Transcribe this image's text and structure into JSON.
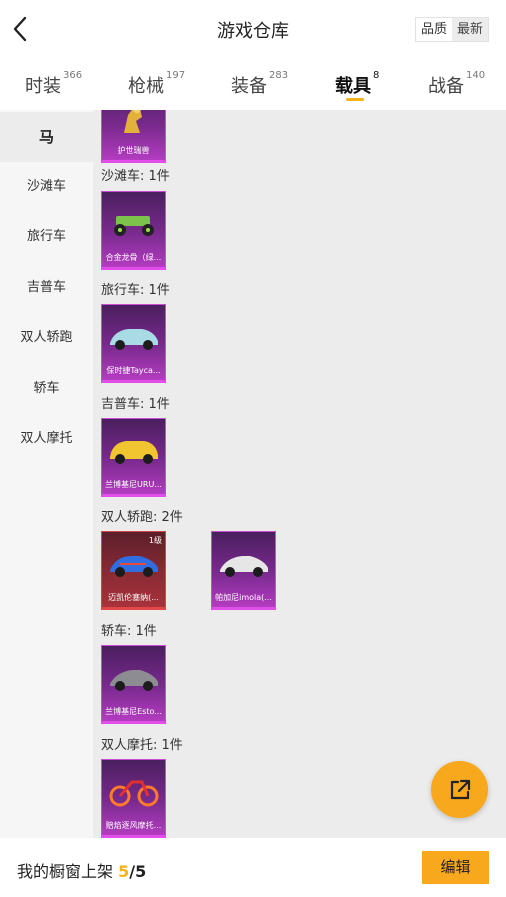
{
  "header": {
    "title": "游戏仓库",
    "sort_quality": "品质",
    "sort_newest": "最新"
  },
  "tabs": [
    {
      "label": "时装",
      "count": "366"
    },
    {
      "label": "枪械",
      "count": "197"
    },
    {
      "label": "装备",
      "count": "283"
    },
    {
      "label": "载具",
      "count": "8"
    },
    {
      "label": "战备",
      "count": "140"
    }
  ],
  "sidebar": [
    "马",
    "沙滩车",
    "旅行车",
    "吉普车",
    "双人轿跑",
    "轿车",
    "双人摩托"
  ],
  "sections": [
    {
      "label": "",
      "items": [
        {
          "name": "护世瑞兽"
        }
      ]
    },
    {
      "label": "沙滩车: 1件",
      "items": [
        {
          "name": "合金龙骨（绿..."
        }
      ]
    },
    {
      "label": "旅行车: 1件",
      "items": [
        {
          "name": "保时捷Tayca..."
        }
      ]
    },
    {
      "label": "吉普车: 1件",
      "items": [
        {
          "name": "兰博基尼URU..."
        }
      ]
    },
    {
      "label": "双人轿跑: 2件",
      "items": [
        {
          "name": "迈凯伦塞纳(...",
          "level": "1级"
        },
        {
          "name": "帕加尼imola(..."
        }
      ]
    },
    {
      "label": "轿车: 1件",
      "items": [
        {
          "name": "兰博基尼Esto..."
        }
      ]
    },
    {
      "label": "双人摩托: 1件",
      "items": [
        {
          "name": "赔焰逐风摩托..."
        }
      ]
    }
  ],
  "footer": {
    "label": "我的橱窗上架",
    "shown": "5",
    "slash": "/",
    "total": "5",
    "edit_button": "编辑"
  },
  "colors": {
    "accent": "#f7a81c",
    "card_purple": "#b33cc0",
    "card_red": "#a8323a"
  }
}
